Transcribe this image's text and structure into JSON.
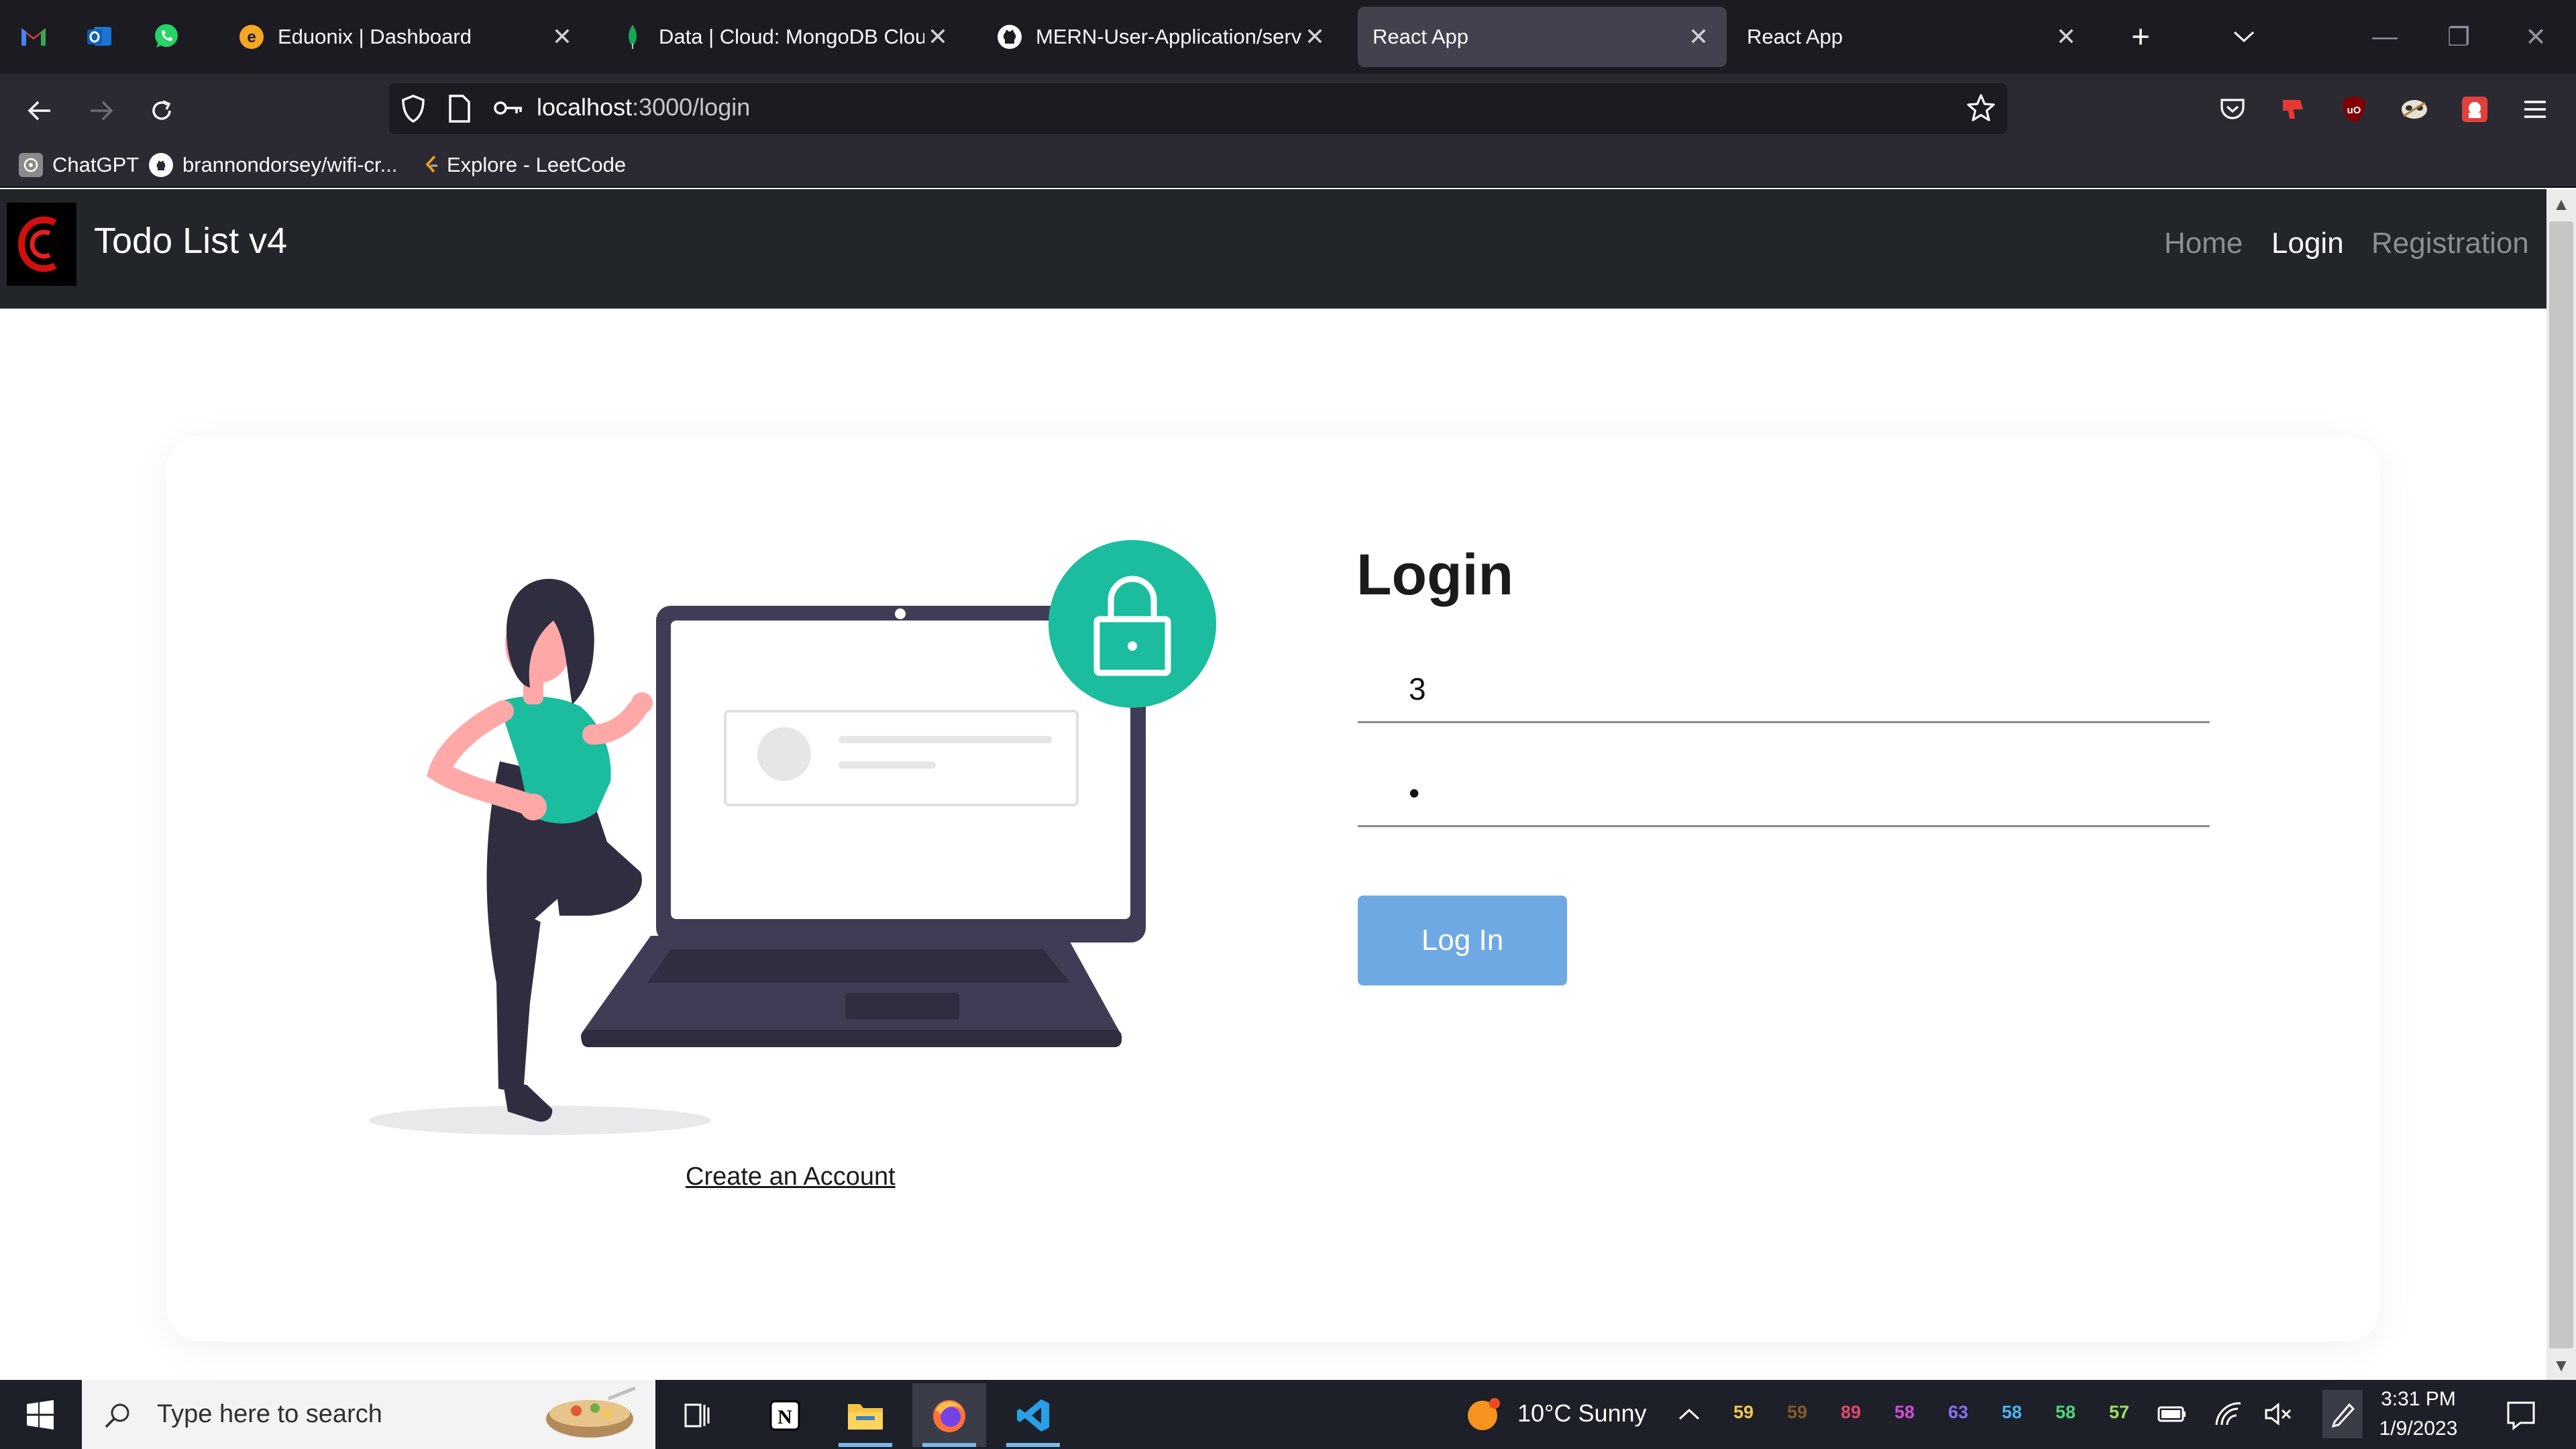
{
  "browser": {
    "tabs": [
      {
        "title": "Eduonix | Dashboard",
        "active": false
      },
      {
        "title": "Data | Cloud: MongoDB Cloud",
        "active": false
      },
      {
        "title": "MERN-User-Application/server",
        "active": false
      },
      {
        "title": "React App",
        "active": true
      },
      {
        "title": "React App",
        "active": false
      }
    ],
    "url": {
      "host": "localhost",
      "path": ":3000/login"
    },
    "bookmarks": [
      {
        "label": "ChatGPT"
      },
      {
        "label": "brannondorsey/wifi-cr..."
      },
      {
        "label": "Explore - LeetCode"
      }
    ]
  },
  "app": {
    "brand": "Todo List v4",
    "nav": [
      {
        "label": "Home",
        "active": false
      },
      {
        "label": "Login",
        "active": true
      },
      {
        "label": "Registration",
        "active": false
      }
    ],
    "accent_color": "#6fa9e4",
    "teal_color": "#1bbd9e"
  },
  "login": {
    "title": "Login",
    "username_value": "3",
    "password_value": "1",
    "button_label": "Log In",
    "create_account": "Create an Account"
  },
  "taskbar": {
    "search_placeholder": "Type here to search",
    "weather": "10°C  Sunny",
    "tray_numbers": [
      {
        "value": "59",
        "color": "#f2c94c"
      },
      {
        "value": "59",
        "color": "#8a5a2b"
      },
      {
        "value": "89",
        "color": "#e2476a"
      },
      {
        "value": "58",
        "color": "#d14dd6"
      },
      {
        "value": "63",
        "color": "#8b6ff0"
      },
      {
        "value": "58",
        "color": "#4ab3f4"
      },
      {
        "value": "58",
        "color": "#4fd67a"
      },
      {
        "value": "57",
        "color": "#9be15d"
      }
    ],
    "time": "3:31 PM",
    "date": "1/9/2023"
  }
}
